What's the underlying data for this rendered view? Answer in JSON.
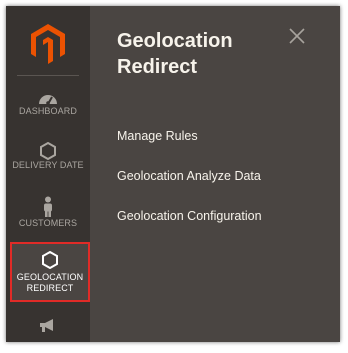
{
  "sidebar": {
    "logo_icon": "magento-logo",
    "accent_color": "#eb5202",
    "items": [
      {
        "label": "DASHBOARD",
        "icon": "speedometer-icon"
      },
      {
        "label": "DELIVERY DATE",
        "icon": "hexagon-icon"
      },
      {
        "label": "CUSTOMERS",
        "icon": "person-icon"
      },
      {
        "label": "GEOLOCATION REDIRECT",
        "label_line1": "GEOLOCATION",
        "label_line2": "REDIRECT",
        "icon": "hexagon-icon",
        "active": true,
        "highlight_color": "#e02b27"
      },
      {
        "label": "",
        "icon": "megaphone-icon"
      }
    ]
  },
  "flyout": {
    "title_line1": "Geolocation",
    "title_line2": "Redirect",
    "close_icon": "close-icon",
    "items": [
      {
        "label": "Manage Rules"
      },
      {
        "label": "Geolocation Analyze Data"
      },
      {
        "label": "Geolocation Configuration"
      }
    ]
  }
}
